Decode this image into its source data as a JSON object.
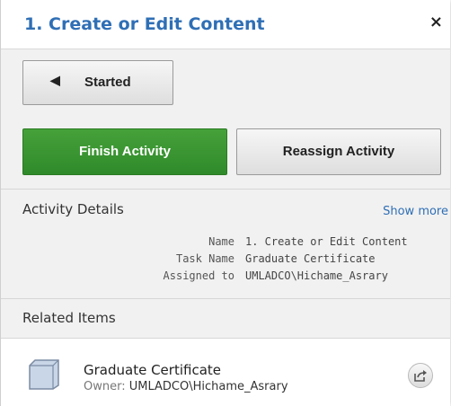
{
  "header": {
    "title": "1. Create or Edit Content",
    "close_symbol": "×"
  },
  "status_button": {
    "label": "Started",
    "icon": "back-arrow-icon"
  },
  "actions": {
    "finish_label": "Finish Activity",
    "reassign_label": "Reassign Activity"
  },
  "colors": {
    "accent": "#2f6fb5",
    "finish_green": "#3a962f"
  },
  "activity_details": {
    "title": "Activity Details",
    "show_more": "Show more",
    "rows": [
      {
        "key": "Name",
        "value": "1. Create or Edit Content"
      },
      {
        "key": "Task Name",
        "value": "Graduate Certificate"
      },
      {
        "key": "Assigned to",
        "value": "UMLADCO\\Hichame_Asrary"
      }
    ]
  },
  "related_items": {
    "title": "Related Items",
    "items": [
      {
        "name": "Graduate Certificate",
        "owner_label": "Owner:",
        "owner_value": "UMLADCO\\Hichame_Asrary",
        "icon": "content-item-icon",
        "action_icon": "share-icon"
      }
    ]
  }
}
